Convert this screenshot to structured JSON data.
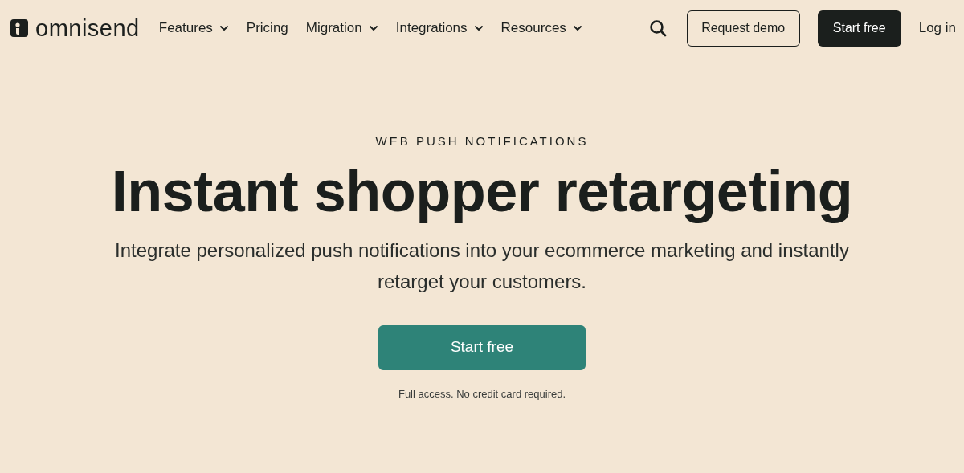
{
  "header": {
    "logo": "omnisend",
    "nav": [
      {
        "label": "Features",
        "kind": "dropdown"
      },
      {
        "label": "Pricing",
        "kind": "link"
      },
      {
        "label": "Migration",
        "kind": "dropdown"
      },
      {
        "label": "Integrations",
        "kind": "dropdown"
      },
      {
        "label": "Resources",
        "kind": "dropdown"
      }
    ],
    "request_demo": "Request demo",
    "start_free": "Start free",
    "log_in": "Log in"
  },
  "hero": {
    "eyebrow": "WEB PUSH NOTIFICATIONS",
    "title": "Instant shopper retargeting",
    "subtitle": "Integrate personalized push notifications into your ecommerce marketing and instantly retarget your customers.",
    "cta": "Start free",
    "note": "Full access. No credit card required."
  }
}
